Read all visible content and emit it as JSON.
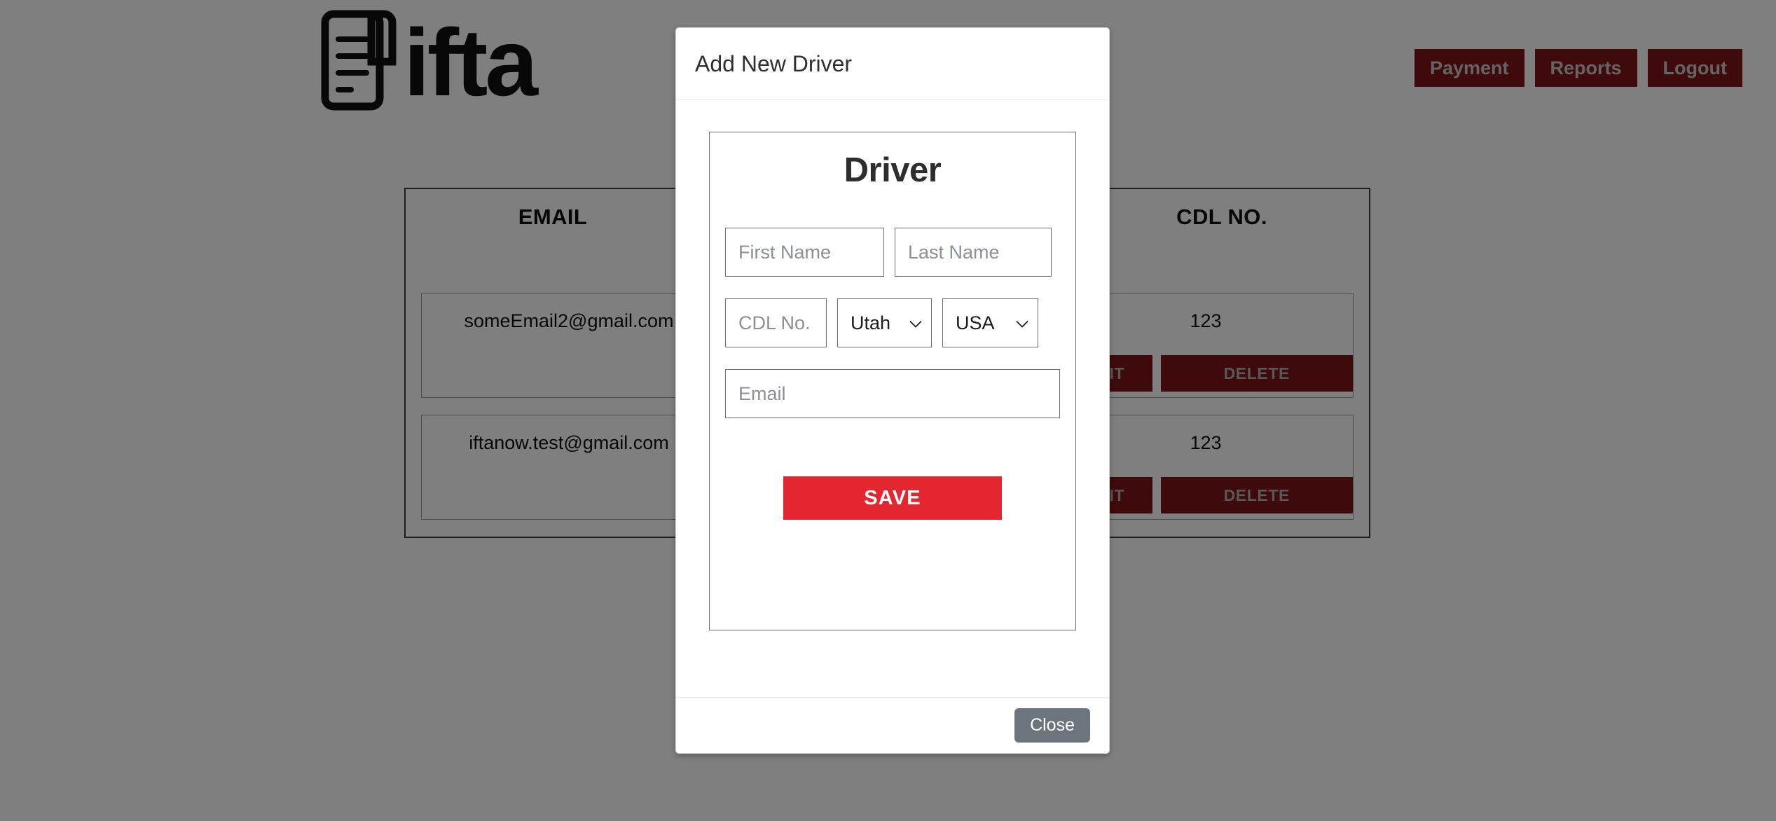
{
  "header": {
    "logo_text": "ifta",
    "logo_icon": "document-lines-icon",
    "nav": [
      {
        "label": "Payment",
        "name": "nav-payment"
      },
      {
        "label": "Reports",
        "name": "nav-reports"
      },
      {
        "label": "Logout",
        "name": "nav-logout"
      }
    ]
  },
  "table": {
    "columns": [
      {
        "key": "email",
        "label": "EMAIL"
      },
      {
        "key": "cdl",
        "label": "CDL NO."
      }
    ],
    "rows": [
      {
        "email": "someEmail2@gmail.com",
        "cdl": "123",
        "edit_label": "EDIT",
        "delete_label": "DELETE"
      },
      {
        "email": "iftanow.test@gmail.com",
        "cdl": "123",
        "edit_label": "EDIT",
        "delete_label": "DELETE"
      }
    ]
  },
  "modal": {
    "title": "Add New Driver",
    "close_label": "Close",
    "card": {
      "heading": "Driver",
      "fields": {
        "first_name": {
          "placeholder": "First Name",
          "value": ""
        },
        "last_name": {
          "placeholder": "Last Name",
          "value": ""
        },
        "cdl_no": {
          "placeholder": "CDL No.",
          "value": ""
        },
        "email": {
          "placeholder": "Email",
          "value": ""
        }
      },
      "state_select": {
        "selected": "Utah",
        "icon": "chevron-down-icon"
      },
      "country_select": {
        "selected": "USA",
        "icon": "chevron-down-icon"
      },
      "save_label": "SAVE"
    }
  },
  "colors": {
    "accent_red": "#e42630",
    "dark_red": "#7c1519",
    "close_gray": "#6c757d",
    "overlay": "rgba(0,0,0,0.5)"
  }
}
